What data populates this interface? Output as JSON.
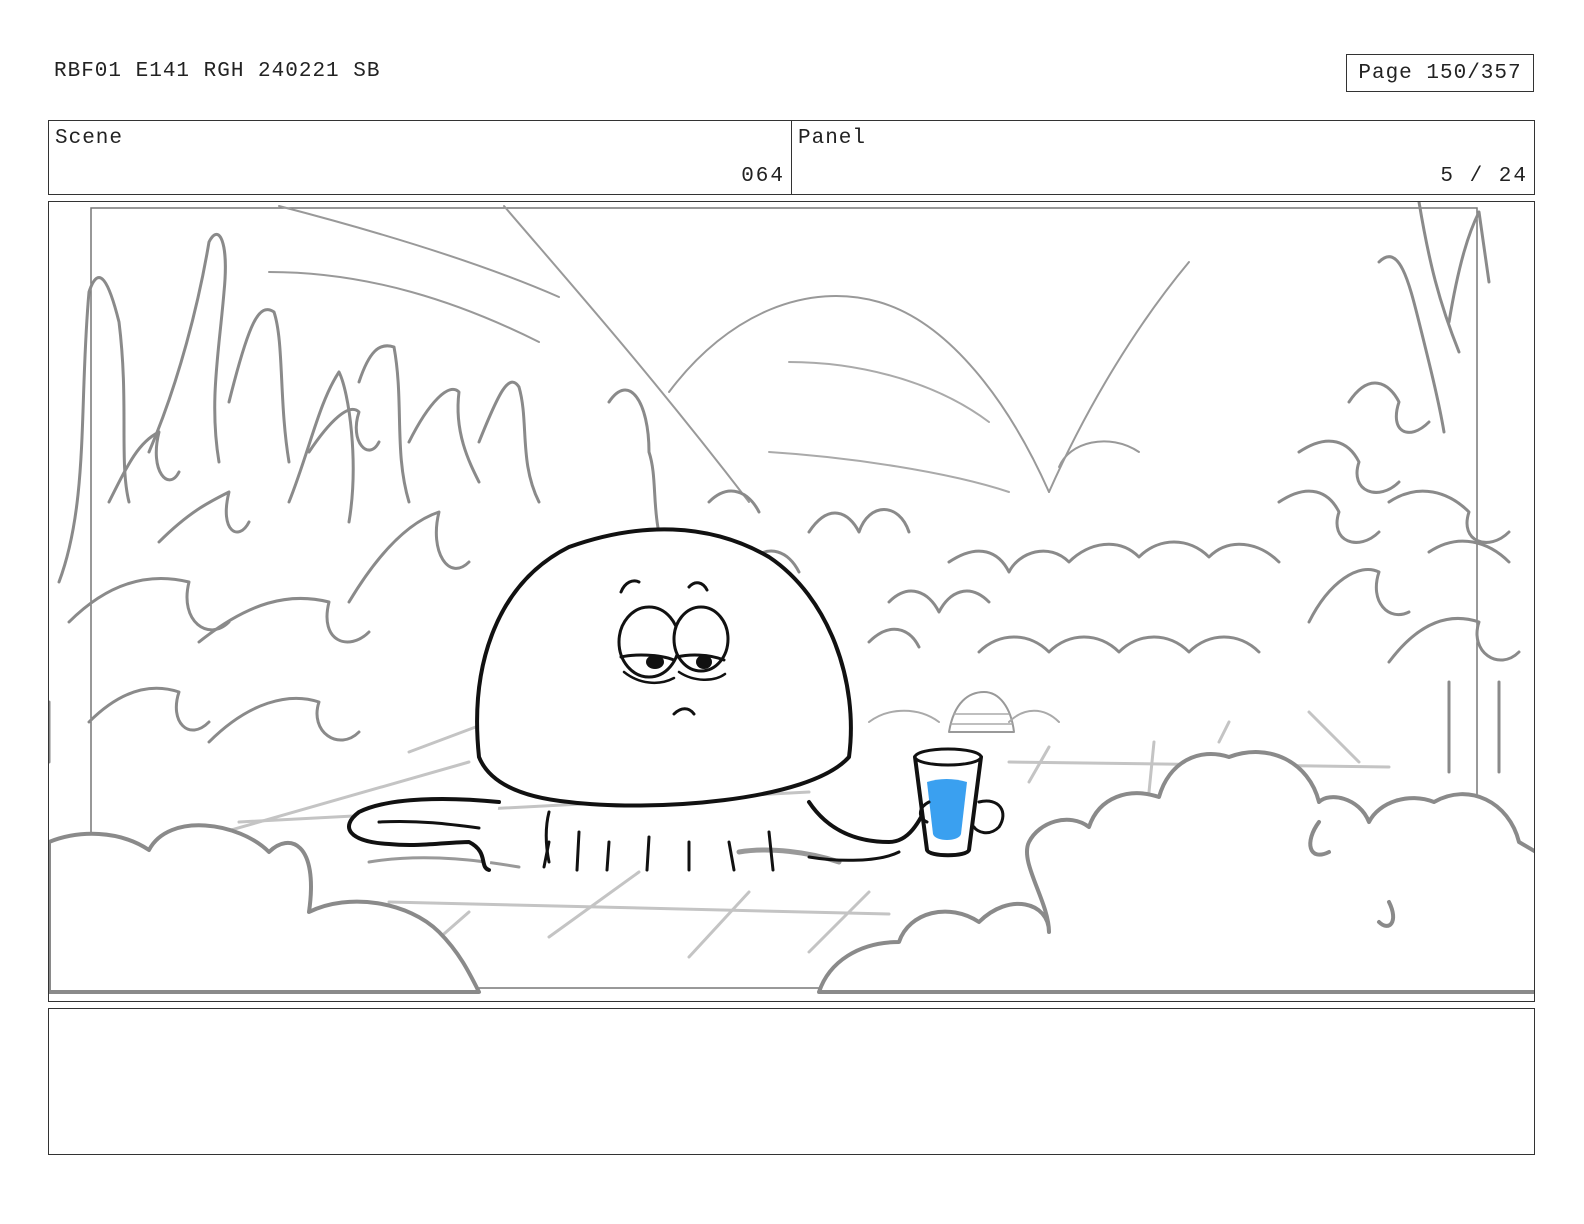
{
  "header": {
    "document_id": "RBF01 E141 RGH 240221 SB",
    "page_label": "Page 150/357"
  },
  "info": {
    "scene_label": "Scene",
    "scene_value": "064",
    "panel_label": "Panel",
    "panel_value": "5 / 24"
  },
  "panel": {
    "water_color": "#3aa0f0",
    "line_color": "#111111",
    "sketch_color": "#8a8a8a"
  },
  "notes": {
    "text": ""
  }
}
